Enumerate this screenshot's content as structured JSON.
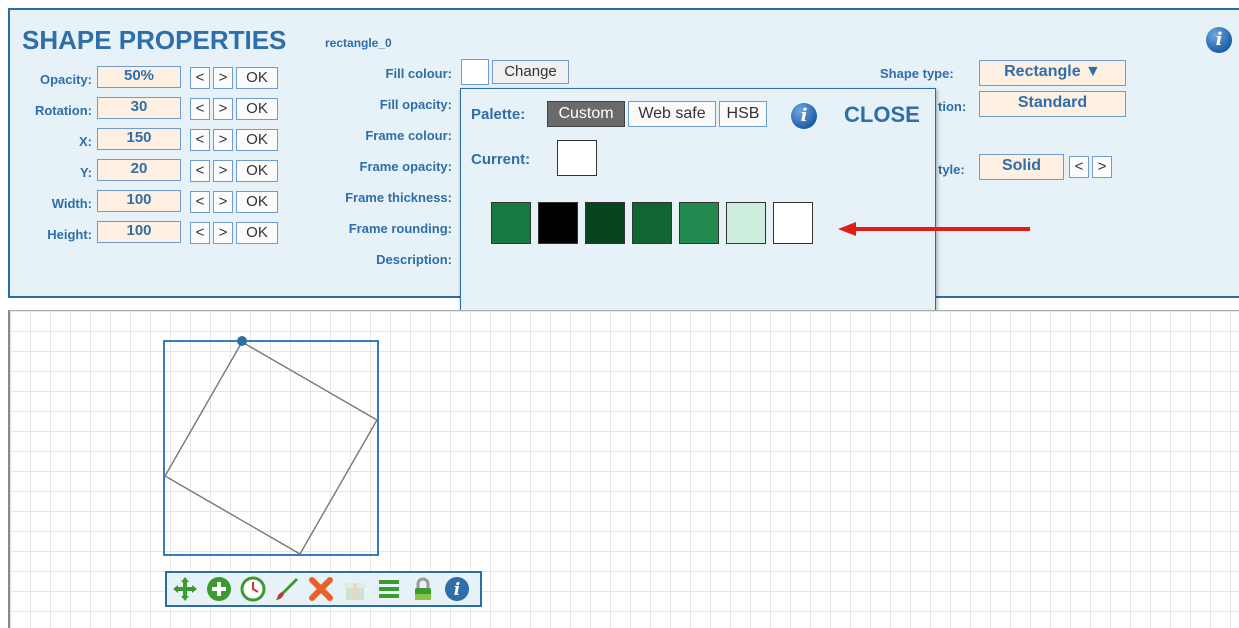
{
  "panel": {
    "title": "SHAPE PROPERTIES",
    "shape_id": "rectangle_0"
  },
  "fields": [
    {
      "label": "Opacity:",
      "value": "50%"
    },
    {
      "label": "Rotation:",
      "value": "30"
    },
    {
      "label": "X:",
      "value": "150"
    },
    {
      "label": "Y:",
      "value": "20"
    },
    {
      "label": "Width:",
      "value": "100"
    },
    {
      "label": "Height:",
      "value": "100"
    }
  ],
  "stepper": {
    "prev": "<",
    "next": ">",
    "ok": "OK"
  },
  "middle_labels": [
    "Fill colour:",
    "Fill opacity:",
    "Frame colour:",
    "Frame opacity:",
    "Frame thickness:",
    "Frame rounding:",
    "Description:"
  ],
  "change_label": "Change",
  "palette": {
    "label": "Palette:",
    "tabs": [
      "Custom",
      "Web safe",
      "HSB"
    ],
    "active_tab": "Custom",
    "close_label": "CLOSE",
    "current_label": "Current:",
    "current_color": "#ffffff",
    "swatches": [
      "#157a3f",
      "#000000",
      "#07441f",
      "#0f6633",
      "#238a4f",
      "#cdeedd",
      "#ffffff"
    ]
  },
  "right": {
    "shape_type_label": "Shape type:",
    "shape_type_value": "Rectangle ▼",
    "partial_label_1": "tion:",
    "partial_value_1": "Standard",
    "partial_label_2": "tyle:",
    "partial_value_2": "Solid",
    "stepper_prev": "<",
    "stepper_next": ">"
  },
  "toolbar_icons": [
    "move-icon",
    "add-icon",
    "clock-icon",
    "brush-icon",
    "delete-icon",
    "gift-icon",
    "menu-icon",
    "lock-icon",
    "info-icon"
  ],
  "colors": {
    "accent": "#2f6ea8",
    "panel_bg": "#e6f2f8",
    "arrow": "#e21b1b"
  }
}
